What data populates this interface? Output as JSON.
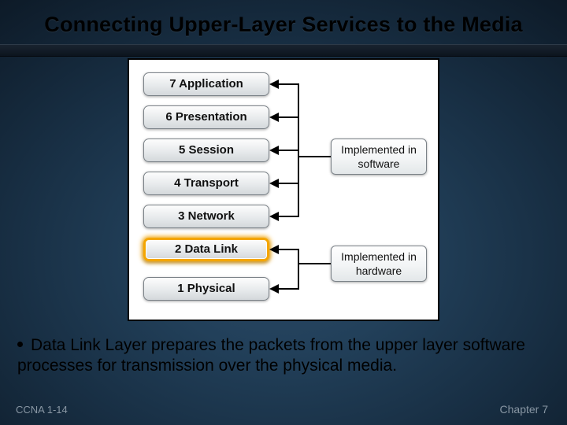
{
  "title": "Connecting Upper-Layer Services to the Media",
  "layers": {
    "l7": "7 Application",
    "l6": "6 Presentation",
    "l5": "5 Session",
    "l4": "4 Transport",
    "l3": "3 Network",
    "l2": "2 Data Link",
    "l1": "1 Physical"
  },
  "impl": {
    "software": "Implemented in software",
    "hardware": "Implemented in hardware"
  },
  "bullet": "Data Link Layer prepares the packets from the upper layer software processes for transmission over the physical media.",
  "footer": {
    "left": "CCNA 1-14",
    "right": "Chapter 7"
  }
}
